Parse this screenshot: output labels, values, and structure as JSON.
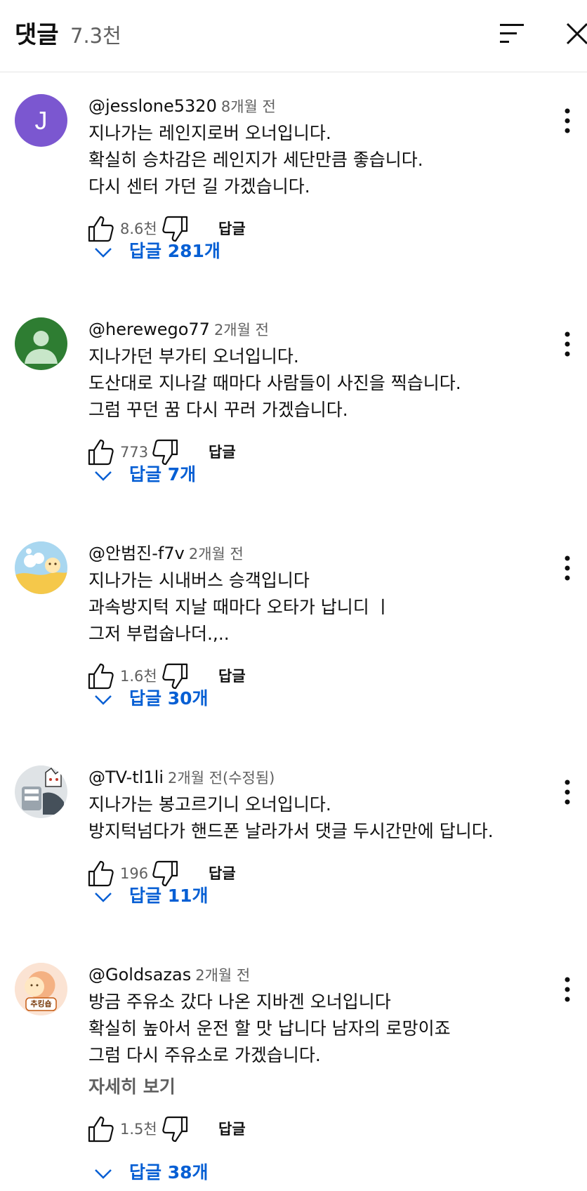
{
  "header": {
    "title": "댓글",
    "count": "7.3천"
  },
  "comments": [
    {
      "avatar_letter": "J",
      "author": "@jesslone5320",
      "time": "8개월 전",
      "lines": [
        "지나가는 레인지로버 오너입니다.",
        "확실히 승차감은 레인지가 세단만큼 좋습니다.",
        "다시 센터 가던 길 가겠습니다."
      ],
      "likes": "8.6천",
      "reply_label": "답글",
      "replies": "답글 281개"
    },
    {
      "author": "@herewego77",
      "time": "2개월 전",
      "lines": [
        "지나가던 부가티 오너입니다.",
        "도산대로 지나갈 때마다 사람들이 사진을 찍습니다.",
        "그럼 꾸던 꿈 다시 꾸러 가겠습니다."
      ],
      "likes": "773",
      "reply_label": "답글",
      "replies": "답글 7개"
    },
    {
      "author": "@안범진-f7v",
      "time": "2개월 전",
      "lines": [
        "지나가는 시내버스 승객입니다",
        "과속방지턱 지날 때마다 오타가 납니디 ㅣ",
        "그저 부럽숩나더.,.."
      ],
      "likes": "1.6천",
      "reply_label": "답글",
      "replies": "답글 30개"
    },
    {
      "author": "@TV-tl1li",
      "time": "2개월 전(수정됨)",
      "lines": [
        "지나가는 봉고르기니 오너입니다.",
        "방지턱넘다가 핸드폰 날라가서 댓글 두시간만에 답니다."
      ],
      "likes": "196",
      "reply_label": "답글",
      "replies": "답글 11개"
    },
    {
      "author": "@Goldsazas",
      "time": "2개월 전",
      "lines": [
        "방금 주유소 갔다 나온 지바겐 오너입니다",
        "확실히 높아서 운전 할 맛 납니다 남자의 로망이죠",
        "그럼 다시 주유소로 가겠습니다."
      ],
      "read_more": "자세히 보기",
      "avatar_badge": "추킹숍",
      "likes": "1.5천",
      "reply_label": "답글",
      "replies": "답글 38개"
    }
  ],
  "colors": {
    "text": "#0f0f0f",
    "secondary": "#606060",
    "link": "#065fd4",
    "avatar_purple": "#7b57d0",
    "avatar_green": "#2e7d32"
  },
  "icons": {
    "sort": "sort-icon",
    "close": "close-icon",
    "more": "more-vert-icon",
    "like": "thumb-up-icon",
    "dislike": "thumb-down-icon",
    "expand": "chevron-down-icon"
  }
}
